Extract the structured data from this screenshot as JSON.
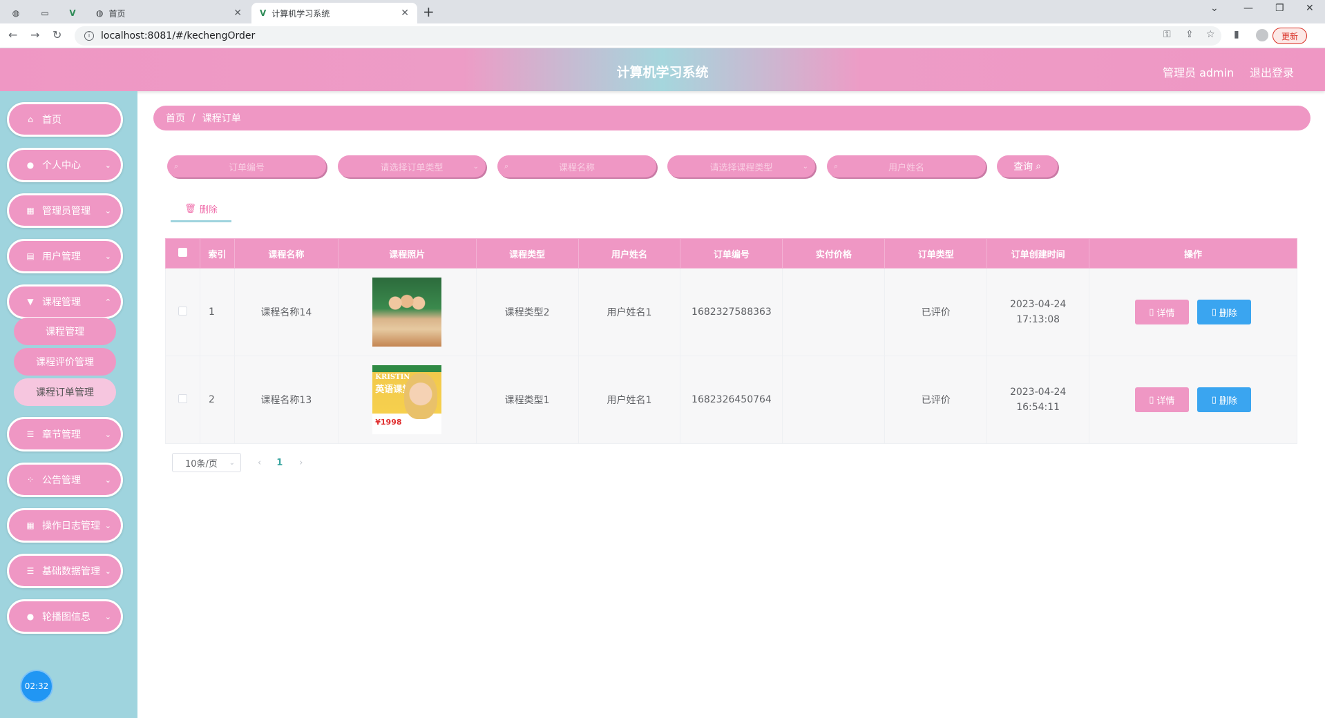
{
  "browser": {
    "tabs": [
      {
        "title": "首页"
      },
      {
        "title": "计算机学习系统"
      }
    ],
    "url": "localhost:8081/#/kechengOrder",
    "update_label": "更新"
  },
  "header": {
    "title": "计算机学习系统",
    "user": "管理员 admin",
    "logout": "退出登录"
  },
  "sidebar": {
    "items": [
      {
        "label": "首页"
      },
      {
        "label": "个人中心"
      },
      {
        "label": "管理员管理"
      },
      {
        "label": "用户管理"
      },
      {
        "label": "课程管理"
      },
      {
        "label": "章节管理"
      },
      {
        "label": "公告管理"
      },
      {
        "label": "操作日志管理"
      },
      {
        "label": "基础数据管理"
      },
      {
        "label": "轮播图信息"
      }
    ],
    "subitems": [
      {
        "label": "课程管理"
      },
      {
        "label": "课程评价管理"
      },
      {
        "label": "课程订单管理"
      }
    ],
    "clock": "02:32"
  },
  "breadcrumb": {
    "home": "首页",
    "sep": "/",
    "current": "课程订单"
  },
  "search": {
    "order_no": "订单编号",
    "order_type": "请选择订单类型",
    "course_name": "课程名称",
    "course_type": "请选择课程类型",
    "user_name": "用户姓名",
    "query": "查询"
  },
  "toolbar": {
    "delete": "删除"
  },
  "table": {
    "headers": [
      "索引",
      "课程名称",
      "课程照片",
      "课程类型",
      "用户姓名",
      "订单编号",
      "实付价格",
      "订单类型",
      "订单创建时间",
      "操作"
    ],
    "rows": [
      {
        "index": "1",
        "name": "课程名称14",
        "type": "课程类型2",
        "user": "用户姓名1",
        "order_no": "1682327588363",
        "price": "",
        "order_type": "已评价",
        "time": "2023-04-24 17:13:08"
      },
      {
        "index": "2",
        "name": "课程名称13",
        "type": "课程类型1",
        "user": "用户姓名1",
        "order_no": "1682326450764",
        "price": "",
        "order_type": "已评价",
        "time": "2023-04-24 16:54:11"
      }
    ],
    "detail_label": "详情",
    "delete_label": "删除",
    "thumb2_text": {
      "a": "KRISTIN",
      "b": "英语课堂",
      "c": "¥1998"
    }
  },
  "pager": {
    "size": "10条/页",
    "current": "1"
  }
}
